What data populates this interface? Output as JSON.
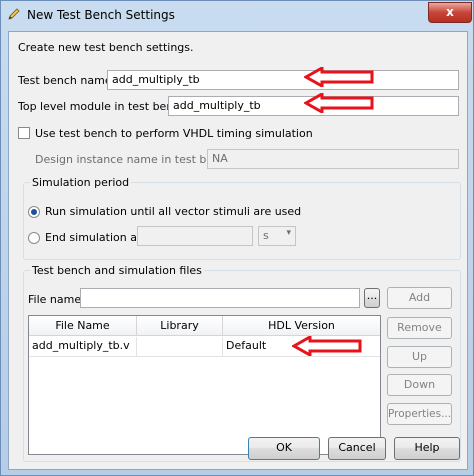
{
  "window": {
    "title": "New Test Bench Settings",
    "close_label": "x"
  },
  "intro": "Create new test bench settings.",
  "test_bench_name": {
    "label": "Test bench name:",
    "value": "add_multiply_tb"
  },
  "top_level_module": {
    "label": "Top level module in test bench:",
    "value": "add_multiply_tb"
  },
  "vhdl_timing": {
    "label": "Use test bench to perform VHDL timing simulation",
    "checked": false
  },
  "design_instance": {
    "label": "Design instance name in test bench:",
    "value": "NA"
  },
  "simulation_period": {
    "title": "Simulation period",
    "run_all_label": "Run simulation until all vector stimuli are used",
    "end_at_label": "End simulation at:",
    "end_at_value": "",
    "unit": "s"
  },
  "files": {
    "title": "Test bench and simulation files",
    "file_name_label": "File name:",
    "file_name_value": "",
    "browse_label": "...",
    "columns": [
      "File Name",
      "Library",
      "HDL Version"
    ],
    "rows": [
      {
        "file_name": "add_multiply_tb.v",
        "library": "",
        "hdl_version": "Default"
      }
    ],
    "buttons": {
      "add": "Add",
      "remove": "Remove",
      "up": "Up",
      "down": "Down",
      "properties": "Properties..."
    }
  },
  "dialog_buttons": {
    "ok": "OK",
    "cancel": "Cancel",
    "help": "Help"
  },
  "colors": {
    "annotation_arrow": "#e8121b",
    "title_bar": "#b6cde6"
  },
  "icons": {
    "title": "pencil-icon",
    "annotation": "red-arrow-icon"
  }
}
